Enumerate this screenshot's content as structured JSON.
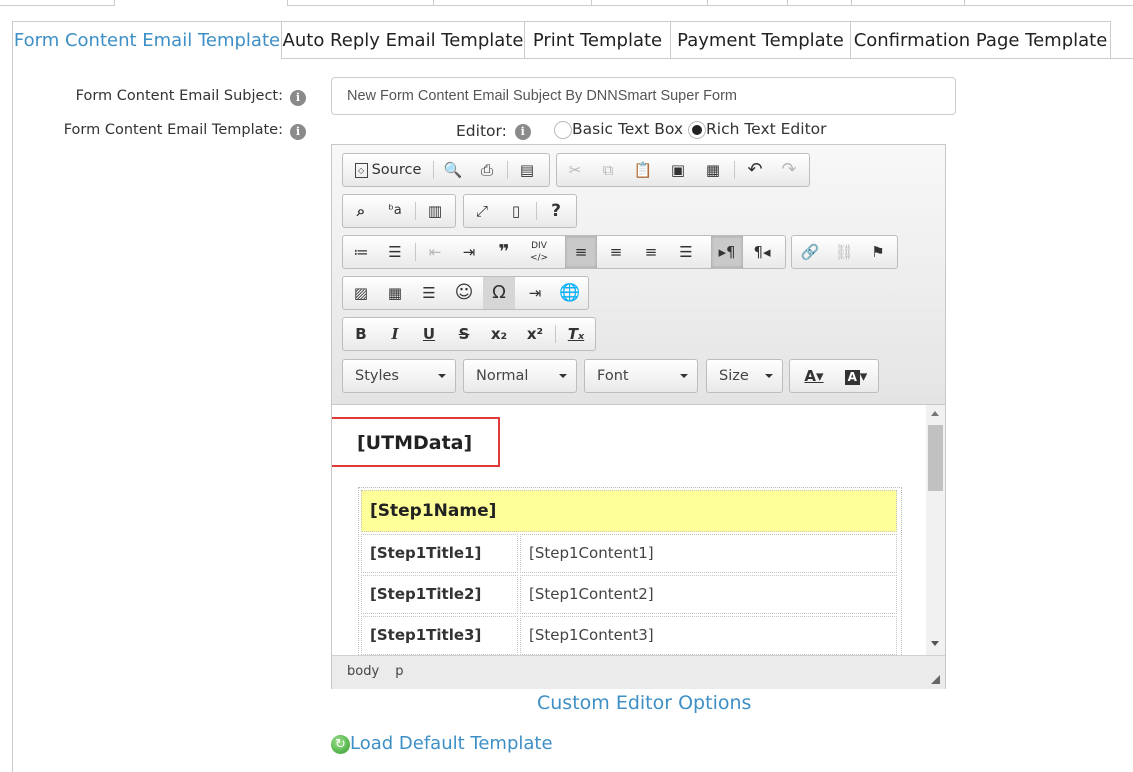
{
  "inner_tabs": [
    "Form Content Email Template",
    "Auto Reply Email Template",
    "Print Template",
    "Payment Template",
    "Confirmation Page Template"
  ],
  "subject": {
    "label": "Form Content Email Subject:",
    "value": "New Form Content Email Subject By DNNSmart Super Form"
  },
  "template": {
    "label": "Form Content Email Template:"
  },
  "editor_choice": {
    "label": "Editor:",
    "option_basic": "Basic Text Box",
    "option_rich": "Rich Text Editor",
    "selected": "Rich Text Editor"
  },
  "toolbar": {
    "source_label": "Source",
    "styles": "Styles",
    "format": "Normal",
    "font": "Font",
    "size": "Size"
  },
  "content": {
    "utm": "[UTMData]",
    "step_name": "[Step1Name]",
    "rows": [
      {
        "title": "[Step1Title1]",
        "content": "[Step1Content1]"
      },
      {
        "title": "[Step1Title2]",
        "content": "[Step1Content2]"
      },
      {
        "title": "[Step1Title3]",
        "content": "[Step1Content3]"
      }
    ]
  },
  "status_path": [
    "body",
    "p"
  ],
  "links": {
    "custom_options": "Custom Editor Options",
    "load_default": "Load Default Template"
  },
  "colors": {
    "accent": "#3d8fc6",
    "highlight_box": "#e03a3a",
    "step_header_bg": "#ffff99"
  }
}
